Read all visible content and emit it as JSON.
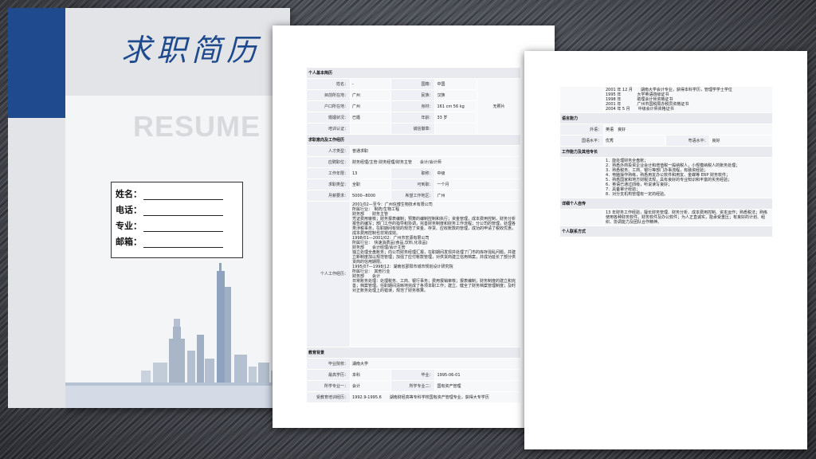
{
  "cover": {
    "title": "求职简历",
    "watermark": "RESUME",
    "fields": [
      "姓名：",
      "电话：",
      "专业：",
      "邮箱："
    ],
    "accent": "#1f4b8e"
  },
  "page2": {
    "basic_title": "个人基本简历",
    "basic": {
      "name_label": "姓名：",
      "name": "-",
      "nation_label": "国籍：",
      "nation": "中国",
      "photo": "无照片",
      "loc_label": "目前所在地：",
      "loc": "广州",
      "ethnic_label": "民族：",
      "ethnic": "汉族",
      "hukou_label": "户口所在地：",
      "hukou": "广州",
      "height_label": "身材：",
      "height": "161 cm  56 kg",
      "marital_label": "婚姻状况：",
      "marital": "已婚",
      "age_label": "年龄：",
      "age": "33 岁",
      "train_label": "培训认证：",
      "train": "",
      "credit_label": "诚信徽章：",
      "credit": ""
    },
    "intent_title": "求职意向及工作经历",
    "intent": {
      "type_label": "人才类型：",
      "type": "普通求职",
      "post_label": "应聘职位：",
      "post": "财务经理/主管:财务经理/财务主管　　会计/会计师",
      "years_label": "工作年限：",
      "years": "13",
      "title_label": "职称：",
      "title": "中级",
      "kind_label": "求职类型：",
      "kind": "全职",
      "arrive_label": "可到职：",
      "arrive": "一个月",
      "salary_label": "月薪要求：",
      "salary": "5000--8000",
      "area_label": "希望工作地区：",
      "area": "广州"
    },
    "work_label": "个人工作经历：",
    "work": [
      "2001/02—至今：广州信博生物技术有限公司",
      "所属行业：　制药/生物工程",
      "财务部　　财务主管",
      "凭证费用审核；财务报表编制；预算的编制控制和执行；资金管理，成本费用控制，财务分析报告的编写；部门工作的指导和协调，完善财务制度和财务工作流程；分公司的管理，处理各类涉税事务，在职期间有效的规范了资金、存货、应收账款的管理，成功的申请了税收优惠，成本费用控制也非常成效。",
      "1998/01—2001/02：广州市宏源有限公司",
      "所属行业：　快速消费品(食品,饮料,化妆品)",
      "财务部　　会计经理/会计主管",
      "独立处理全盘账务；向公司财务经理汇报，在职期间发现并处理了门市的库存混乱问题，并建立新制度加以规范管理；加强了应付帐款管理，对供货商建立信用档案，并成功延长了部分供货商的信用期限。",
      "1995/07—1998/12：湖南省邵阳市城市规划设计研究院",
      "所属行业：　其他行业",
      "财务部　　会计",
      "日常账务处理：处理税务、工商、银行事务；费用报销审核；报表编制；财务制度的建立和完善；档案管理。任职期间清晰地完成了各项本职工作；建立、健全了财务档案管理制度；及时对正账务处理上的错误，规范了财务核算。"
    ],
    "edu_title": "教育背景",
    "edu": {
      "school_label": "毕业院校：",
      "school": "湖南大学",
      "degree_label": "最高学历：",
      "degree": "本科",
      "grad_label": "毕业：",
      "grad": "1995-06-01",
      "major1_label": "所学专业一：",
      "major1": "会计",
      "major2_label": "所学专业二：",
      "major2": "国有资产管理",
      "train_label": "受教育培训经历：",
      "train": "1992.9-1995.6　　湖南财经高等专科学校国有资产管理专业，获得大专学历"
    }
  },
  "page3": {
    "certs": [
      "2001 年 12 月　　湖南大学会计专业，获得本科学历，管理学学士学位",
      "1995 年　　　　大学英语四级证书",
      "1998 年　　　　助理会计师资格证书",
      "2001 年　　　　广州市国税局办税员资格证书",
      "2004 年 5 月　　中级会计师资格证书"
    ],
    "lang_title": "语言能力",
    "lang": {
      "foreign_label": "外语：",
      "foreign": "英语　良好",
      "mandarin_label": "国语水平：",
      "mandarin": "优秀",
      "cantonese_label": "粤语水平：",
      "cantonese": "良好"
    },
    "skills_title": "工作能力及其他专长",
    "skills": [
      "1．能处理财务全盘账；",
      "2．熟悉外商投资企业会计和增值税一般纳税人，小规模纳税人的账务处理；",
      "3．熟悉税务、工商、银行等部门办事流程，有融资经验；",
      "4．电脑操作熟练，熟悉用友办公软件和用友、金蝶等 ERP 财务软件；",
      "5．熟悉国家和地方财税法规，具有良好的专业知识和丰富的实务经验；",
      "6．英语已通过四级，听说读写良好；",
      "7．具备审计经验；",
      "8．对分支机构管理有一定的经验。"
    ],
    "intro_title": "详细个人自传",
    "intro": "13 年财务工作经验，擅长财务管理、财务分析、成本费用控制、资本运作；熟悉税法；熟练使用各种财务软件。财务软件及办公软件；为人正直诚实，能承受重压；有良好的计划、组织、协调能力及团队合作精神。",
    "contact_title": "个人联系方式"
  }
}
